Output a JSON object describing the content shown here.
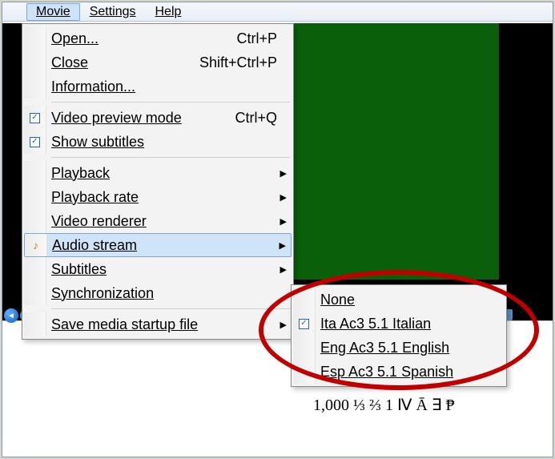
{
  "menubar": {
    "items": [
      "Movie",
      "Settings",
      "Help"
    ]
  },
  "movie_menu": {
    "open": {
      "label": "Open...",
      "shortcut": "Ctrl+P"
    },
    "close": {
      "label": "Close",
      "shortcut": "Shift+Ctrl+P"
    },
    "information": {
      "label": "Information..."
    },
    "video_preview": {
      "label": "Video preview mode",
      "shortcut": "Ctrl+Q",
      "checked": true
    },
    "show_subtitles": {
      "label": "Show subtitles",
      "checked": true
    },
    "playback": {
      "label": "Playback",
      "submenu": true
    },
    "playback_rate": {
      "label": "Playback rate",
      "submenu": true
    },
    "video_renderer": {
      "label": "Video renderer",
      "submenu": true
    },
    "audio_stream": {
      "label": "Audio stream",
      "submenu": true,
      "highlighted": true
    },
    "subtitles": {
      "label": "Subtitles",
      "submenu": true
    },
    "synchronization": {
      "label": "Synchronization"
    },
    "save_startup": {
      "label": "Save media startup file",
      "submenu": true
    }
  },
  "audio_stream_submenu": {
    "items": [
      {
        "id": "none",
        "label": "None",
        "checked": false
      },
      {
        "id": "ita",
        "label": "Ita Ac3 5.1 Italian",
        "checked": true
      },
      {
        "id": "eng",
        "label": "Eng Ac3 5.1 English",
        "checked": false
      },
      {
        "id": "esp",
        "label": "Esp Ac3 5.1 Spanish",
        "checked": false
      }
    ]
  },
  "status_bar": {
    "sample_text": "1,000 ⅓ ⅔ 1 Ⅳ Ā ∃ ₱"
  },
  "annotation": {
    "ellipse_color": "#c00000"
  }
}
